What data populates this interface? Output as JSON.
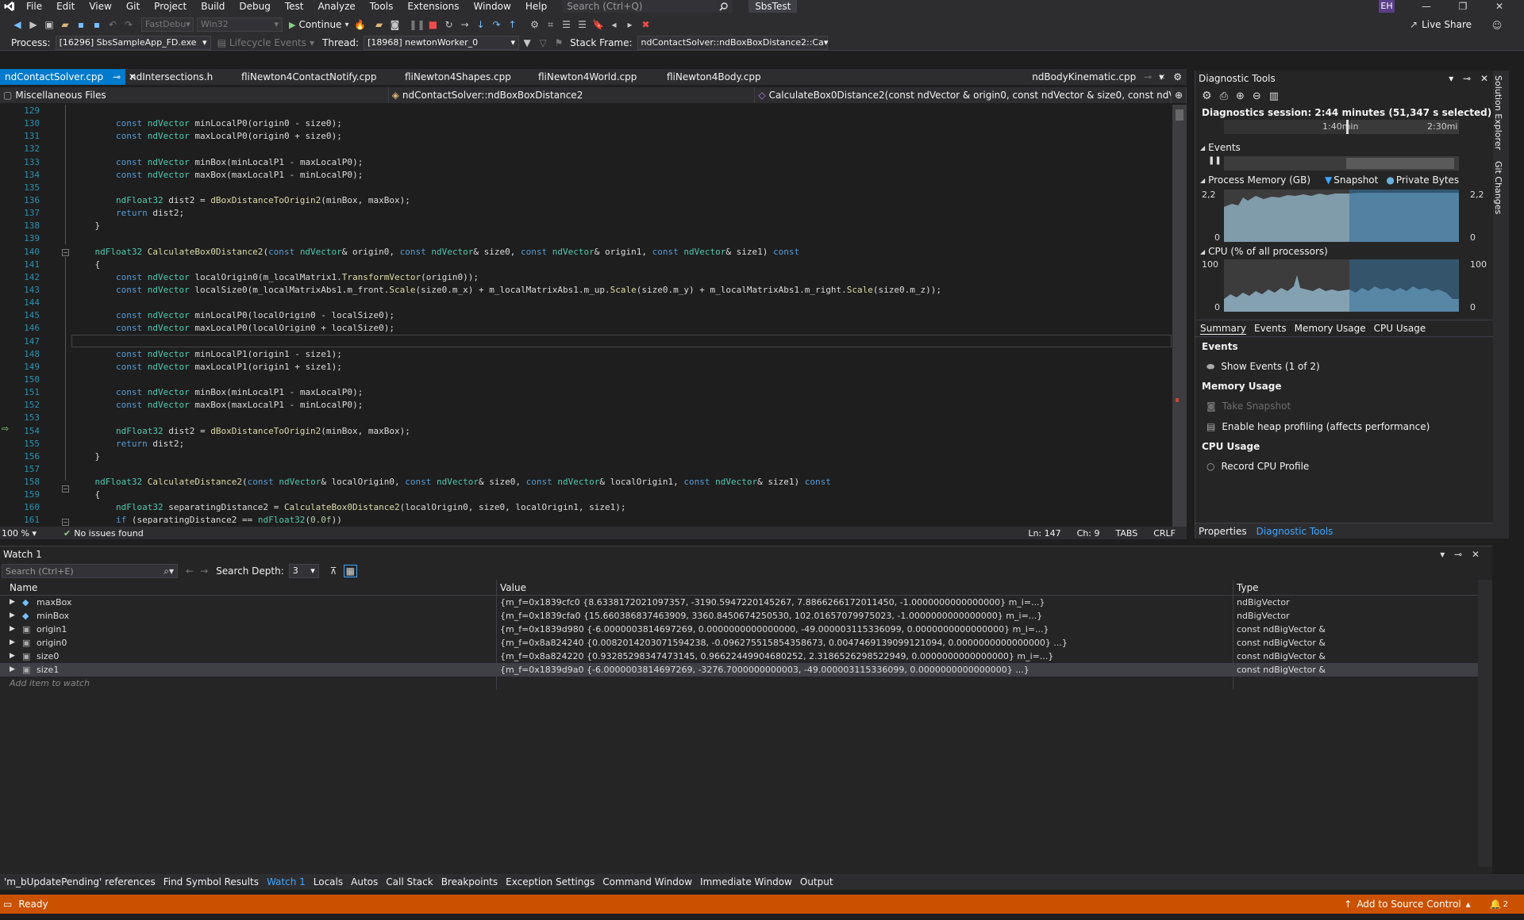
{
  "menu": {
    "items": [
      "File",
      "Edit",
      "View",
      "Git",
      "Project",
      "Build",
      "Debug",
      "Test",
      "Analyze",
      "Tools",
      "Extensions",
      "Window",
      "Help"
    ],
    "search_placeholder": "Search (Ctrl+Q)",
    "solution_name": "SbsTest",
    "user_initials": "EH"
  },
  "toolbar": {
    "config": "FastDebu",
    "platform": "Win32",
    "continue_label": "Continue",
    "live_share": "Live Share",
    "process_label": "Process:",
    "process_value": "[16296] SbsSampleApp_FD.exe",
    "lifecycle_label": "Lifecycle Events",
    "thread_label": "Thread:",
    "thread_value": "[18968] newtonWorker_0",
    "stack_label": "Stack Frame:",
    "stack_value": "ndContactSolver::ndBoxBoxDistance2::Ca"
  },
  "tabs": [
    {
      "label": "ndContactSolver.cpp",
      "active": true
    },
    {
      "label": "ndIntersections.h",
      "active": false
    },
    {
      "label": "fliNewton4ContactNotify.cpp",
      "active": false
    },
    {
      "label": "fliNewton4Shapes.cpp",
      "active": false
    },
    {
      "label": "fliNewton4World.cpp",
      "active": false
    },
    {
      "label": "fliNewton4Body.cpp",
      "active": false
    },
    {
      "label": "ndBodyKinematic.cpp",
      "active": false
    }
  ],
  "navbar": {
    "project": "Miscellaneous Files",
    "scope": "ndContactSolver::ndBoxBoxDistance2",
    "member": "CalculateBox0Distance2(const ndVector & origin0, const ndVector & size0, const ndVector &"
  },
  "code_lines": [
    {
      "n": "129",
      "t": "",
      "html": ""
    },
    {
      "n": "130",
      "t": "        const ndVector minLocalP0(origin0 - size0);"
    },
    {
      "n": "131",
      "t": "        const ndVector maxLocalP0(origin0 + size0);"
    },
    {
      "n": "132",
      "t": ""
    },
    {
      "n": "133",
      "t": "        const ndVector minBox(minLocalP1 - maxLocalP0);"
    },
    {
      "n": "134",
      "t": "        const ndVector maxBox(maxLocalP1 - minLocalP0);"
    },
    {
      "n": "135",
      "t": ""
    },
    {
      "n": "136",
      "t": "        ndFloat32 dist2 = dBoxDistanceToOrigin2(minBox, maxBox);"
    },
    {
      "n": "137",
      "t": "        return dist2;"
    },
    {
      "n": "138",
      "t": "    }"
    },
    {
      "n": "139",
      "t": ""
    },
    {
      "n": "140",
      "t": "    ndFloat32 CalculateBox0Distance2(const ndVector& origin0, const ndVector& size0, const ndVector& origin1, const ndVector& size1) const"
    },
    {
      "n": "141",
      "t": "    {"
    },
    {
      "n": "142",
      "t": "        const ndVector localOrigin0(m_localMatrix1.TransformVector(origin0));"
    },
    {
      "n": "143",
      "t": "        const ndVector localSize0(m_localMatrixAbs1.m_front.Scale(size0.m_x) + m_localMatrixAbs1.m_up.Scale(size0.m_y) + m_localMatrixAbs1.m_right.Scale(size0.m_z));"
    },
    {
      "n": "144",
      "t": ""
    },
    {
      "n": "145",
      "t": "        const ndVector minLocalP0(localOrigin0 - localSize0);"
    },
    {
      "n": "146",
      "t": "        const ndVector maxLocalP0(localOrigin0 + localSize0);"
    },
    {
      "n": "147",
      "t": ""
    },
    {
      "n": "148",
      "t": "        const ndVector minLocalP1(origin1 - size1);"
    },
    {
      "n": "149",
      "t": "        const ndVector maxLocalP1(origin1 + size1);"
    },
    {
      "n": "150",
      "t": ""
    },
    {
      "n": "151",
      "t": "        const ndVector minBox(minLocalP1 - maxLocalP0);"
    },
    {
      "n": "152",
      "t": "        const ndVector maxBox(maxLocalP1 - minLocalP0);"
    },
    {
      "n": "153",
      "t": ""
    },
    {
      "n": "154",
      "t": "        ndFloat32 dist2 = dBoxDistanceToOrigin2(minBox, maxBox);"
    },
    {
      "n": "155",
      "t": "        return dist2;"
    },
    {
      "n": "156",
      "t": "    }"
    },
    {
      "n": "157",
      "t": ""
    },
    {
      "n": "158",
      "t": "    ndFloat32 CalculateDistance2(const ndVector& localOrigin0, const ndVector& size0, const ndVector& localOrigin1, const ndVector& size1) const"
    },
    {
      "n": "159",
      "t": "    {"
    },
    {
      "n": "160",
      "t": "        ndFloat32 separatingDistance2 = CalculateBox0Distance2(localOrigin0, size0, localOrigin1, size1);"
    },
    {
      "n": "161",
      "t": "        if (separatingDistance2 == ndFloat32(0.0f))"
    }
  ],
  "editor_status": {
    "zoom": "100 %",
    "issues": "No issues found",
    "ln": "Ln: 147",
    "ch": "Ch: 9",
    "tabs": "TABS",
    "eol": "CRLF"
  },
  "diagnostic": {
    "title": "Diagnostic Tools",
    "session": "Diagnostics session: 2:44 minutes (51,347 s selected)",
    "time_marks": [
      "1:40min",
      "2:30mi"
    ],
    "events_label": "Events",
    "memory_label": "Process Memory (GB)",
    "snapshot_label": "Snapshot",
    "private_bytes_label": "Private Bytes",
    "memory_max": "2,2",
    "memory_min": "0",
    "cpu_label": "CPU (% of all processors)",
    "cpu_max": "100",
    "cpu_min": "0",
    "tabs": [
      "Summary",
      "Events",
      "Memory Usage",
      "CPU Usage"
    ],
    "events_section": "Events",
    "show_events": "Show Events (1 of 2)",
    "memory_section": "Memory Usage",
    "take_snapshot": "Take Snapshot",
    "heap_profiling": "Enable heap profiling (affects performance)",
    "cpu_section": "CPU Usage",
    "record_cpu": "Record CPU Profile",
    "bottom_tabs": [
      "Properties",
      "Diagnostic Tools"
    ]
  },
  "sidebar": {
    "solution_explorer": "Solution Explorer",
    "git_changes": "Git Changes"
  },
  "watch": {
    "title": "Watch 1",
    "search_placeholder": "Search (Ctrl+E)",
    "depth_label": "Search Depth:",
    "depth_value": "3",
    "columns": [
      "Name",
      "Value",
      "Type"
    ],
    "rows": [
      {
        "name": "maxBox",
        "value": "{m_f=0x1839cfc0 {8.6338172021097357, -3190.5947220145267, 7.8866266172011450, -1.0000000000000000} m_i=...}",
        "type": "ndBigVector"
      },
      {
        "name": "minBox",
        "value": "{m_f=0x1839cfa0 {15.660386837463909, 3360.8450674250530, 102.01657079975023, -1.0000000000000000} m_i=...}",
        "type": "ndBigVector"
      },
      {
        "name": "origin1",
        "value": "{m_f=0x1839d980 {-6.0000003814697269, 0.0000000000000000, -49.000003115336099, 0.0000000000000000} m_i=...}",
        "type": "const ndBigVector &"
      },
      {
        "name": "origin0",
        "value": "{m_f=0x8a824240 {0.0082014203071594238, -0.096275515854358673, 0.0047469139099121094, 0.0000000000000000} ...}",
        "type": "const ndBigVector &"
      },
      {
        "name": "size0",
        "value": "{m_f=0x8a824220 {0.93285298347473145, 0.96622449904680252, 2.3186526298522949, 0.0000000000000000} m_i=...}",
        "type": "const ndBigVector &"
      },
      {
        "name": "size1",
        "value": "{m_f=0x1839d9a0 {-6.0000003814697269, -3276.7000000000003, -49.000003115336099, 0.0000000000000000} ...}",
        "type": "const ndBigVector &"
      }
    ],
    "add_item": "Add item to watch"
  },
  "bottom_tabs": [
    {
      "label": "'m_bUpdatePending' references",
      "active": false
    },
    {
      "label": "Find Symbol Results",
      "active": false
    },
    {
      "label": "Watch 1",
      "active": true
    },
    {
      "label": "Locals",
      "active": false
    },
    {
      "label": "Autos",
      "active": false
    },
    {
      "label": "Call Stack",
      "active": false
    },
    {
      "label": "Breakpoints",
      "active": false
    },
    {
      "label": "Exception Settings",
      "active": false
    },
    {
      "label": "Command Window",
      "active": false
    },
    {
      "label": "Immediate Window",
      "active": false
    },
    {
      "label": "Output",
      "active": false
    }
  ],
  "status": {
    "ready": "Ready",
    "source_control": "Add to Source Control",
    "notifications": "2"
  },
  "colors": {
    "accent": "#007acc",
    "status_bar": "#ca5100"
  }
}
